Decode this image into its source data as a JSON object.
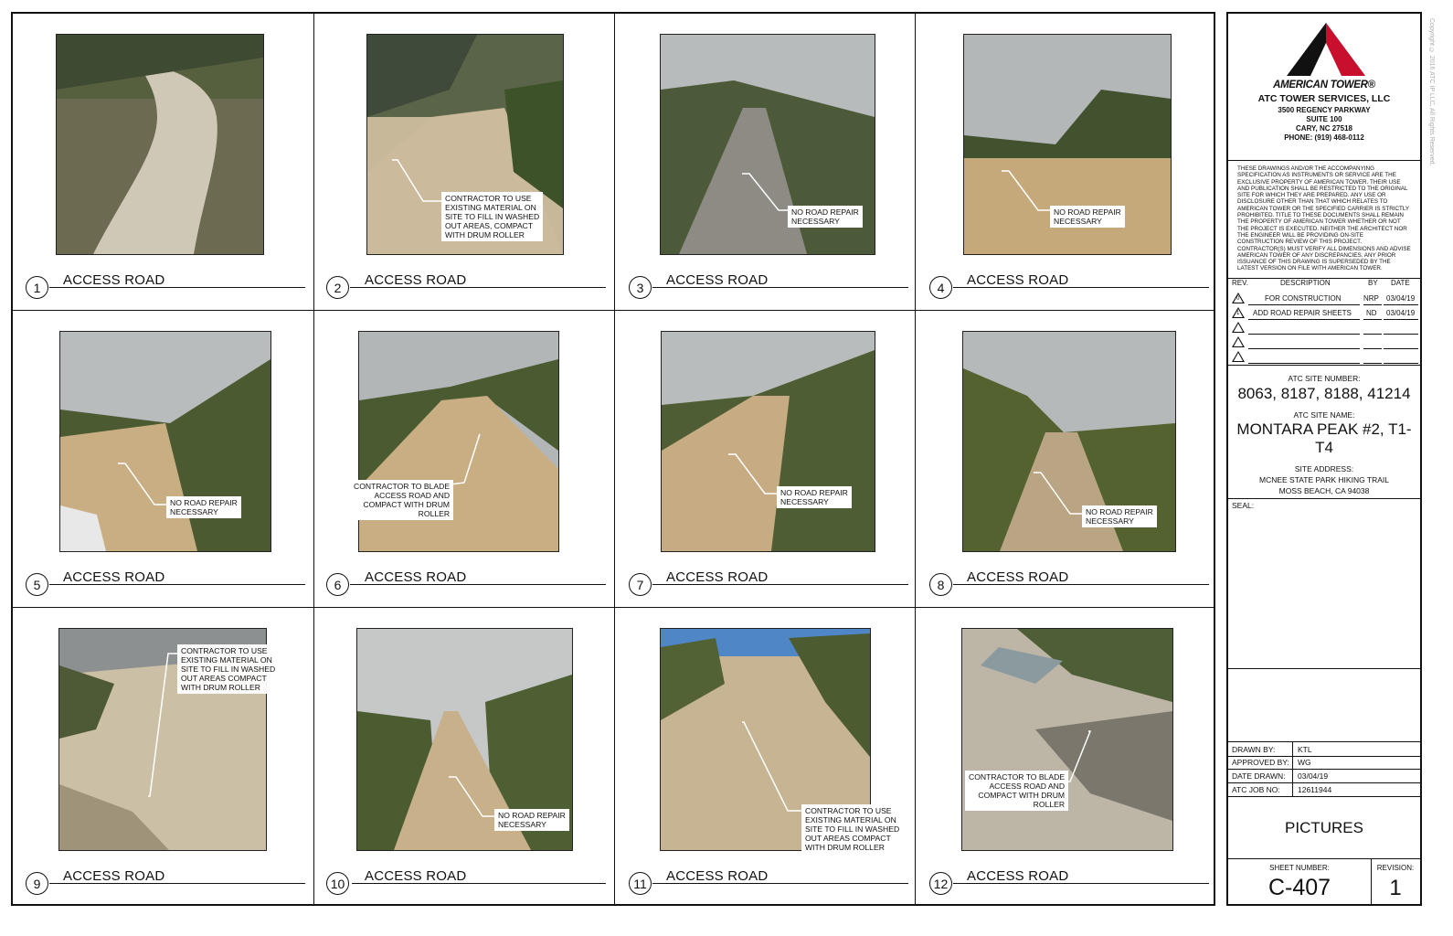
{
  "panels": [
    {
      "number": "1",
      "caption": "ACCESS ROAD",
      "note": ""
    },
    {
      "number": "2",
      "caption": "ACCESS ROAD",
      "note": "CONTRACTOR TO USE\nEXISTING MATERIAL ON\nSITE TO FILL IN WASHED\nOUT AREAS, COMPACT\nWITH DRUM ROLLER"
    },
    {
      "number": "3",
      "caption": "ACCESS ROAD",
      "note": "NO ROAD REPAIR\nNECESSARY"
    },
    {
      "number": "4",
      "caption": "ACCESS ROAD",
      "note": "NO ROAD REPAIR\nNECESSARY"
    },
    {
      "number": "5",
      "caption": "ACCESS ROAD",
      "note": "NO ROAD REPAIR\nNECESSARY"
    },
    {
      "number": "6",
      "caption": "ACCESS ROAD",
      "note": "CONTRACTOR TO BLADE\nACCESS ROAD AND\nCOMPACT WITH DRUM\nROLLER"
    },
    {
      "number": "7",
      "caption": "ACCESS ROAD",
      "note": "NO ROAD REPAIR\nNECESSARY"
    },
    {
      "number": "8",
      "caption": "ACCESS ROAD",
      "note": "NO ROAD REPAIR\nNECESSARY"
    },
    {
      "number": "9",
      "caption": "ACCESS ROAD",
      "note": "CONTRACTOR TO USE\nEXISTING MATERIAL ON\nSITE TO FILL IN WASHED\nOUT AREAS COMPACT\nWITH DRUM ROLLER"
    },
    {
      "number": "10",
      "caption": "ACCESS ROAD",
      "note": "NO ROAD REPAIR\nNECESSARY"
    },
    {
      "number": "11",
      "caption": "ACCESS ROAD",
      "note": "CONTRACTOR TO USE\nEXISTING MATERIAL ON\nSITE TO FILL IN WASHED\nOUT AREAS COMPACT\nWITH DRUM ROLLER"
    },
    {
      "number": "12",
      "caption": "ACCESS ROAD",
      "note": "CONTRACTOR TO BLADE\nACCESS ROAD AND\nCOMPACT WITH DRUM\nROLLER"
    }
  ],
  "title_block": {
    "logo_text": "AMERICAN TOWER®",
    "company": "ATC TOWER SERVICES, LLC",
    "address_lines": [
      "3500 REGENCY PARKWAY",
      "SUITE 100",
      "CARY, NC 27518",
      "PHONE: (919) 468-0112"
    ],
    "disclaimer": "THESE DRAWINGS AND/OR THE ACCOMPANYING SPECIFICATION AS INSTRUMENTS OR SERVICE ARE THE EXCLUSIVE PROPERTY OF AMERICAN TOWER. THEIR USE AND PUBLICATION SHALL BE RESTRICTED TO THE ORIGINAL SITE FOR WHICH THEY ARE PREPARED. ANY USE OR DISCLOSURE OTHER THAN THAT WHICH RELATES TO AMERICAN TOWER OR THE SPECIFIED CARRIER IS STRICTLY PROHIBITED. TITLE TO THESE DOCUMENTS SHALL REMAIN THE PROPERTY OF AMERICAN TOWER WHETHER OR NOT THE PROJECT IS EXECUTED. NEITHER THE ARCHITECT NOR THE ENGINEER WILL BE PROVIDING ON-SITE CONSTRUCTION REVIEW OF THIS PROJECT. CONTRACTOR(S) MUST VERIFY ALL DIMENSIONS AND ADVISE AMERICAN TOWER OF ANY DISCREPANCIES. ANY PRIOR ISSUANCE OF THIS DRAWING IS SUPERSEDED BY THE LATEST VERSION ON FILE WITH AMERICAN TOWER.",
    "revision_headers": {
      "rev": "REV.",
      "description": "DESCRIPTION",
      "by": "BY",
      "date": "DATE"
    },
    "revisions": [
      {
        "rev": "0",
        "description": "FOR CONSTRUCTION",
        "by": "NRP",
        "date": "03/04/19"
      },
      {
        "rev": "1",
        "description": "ADD ROAD REPAIR SHEETS",
        "by": "ND",
        "date": "03/04/19"
      },
      {
        "rev": "",
        "description": "",
        "by": "",
        "date": ""
      },
      {
        "rev": "",
        "description": "",
        "by": "",
        "date": ""
      },
      {
        "rev": "",
        "description": "",
        "by": "",
        "date": ""
      }
    ],
    "site_number_label": "ATC SITE NUMBER:",
    "site_number": "8063, 8187, 8188, 41214",
    "site_name_label": "ATC SITE NAME:",
    "site_name": "MONTARA PEAK #2, T1-T4",
    "site_address_label": "SITE ADDRESS:",
    "site_address_lines": [
      "MCNEE STATE PARK HIKING TRAIL",
      "MOSS BEACH, CA 94038"
    ],
    "seal_label": "SEAL:",
    "drawn_by_label": "DRAWN BY:",
    "drawn_by": "KTL",
    "approved_by_label": "APPROVED BY:",
    "approved_by": "WG",
    "date_drawn_label": "DATE DRAWN:",
    "date_drawn": "03/04/19",
    "job_no_label": "ATC JOB NO:",
    "job_no": "12611944",
    "sheet_title": "PICTURES",
    "sheet_number_label": "SHEET NUMBER:",
    "sheet_number": "C-407",
    "revision_label": "REVISION:",
    "revision": "1",
    "copyright": "Copyright © 2016 ATC IP LLC, All Rights Reserved."
  },
  "colors": {
    "logo_red": "#c8102e",
    "logo_black": "#111111",
    "road": "#c9ae84",
    "foliage": "#4c5a32",
    "fog": "#b9bcbd"
  }
}
